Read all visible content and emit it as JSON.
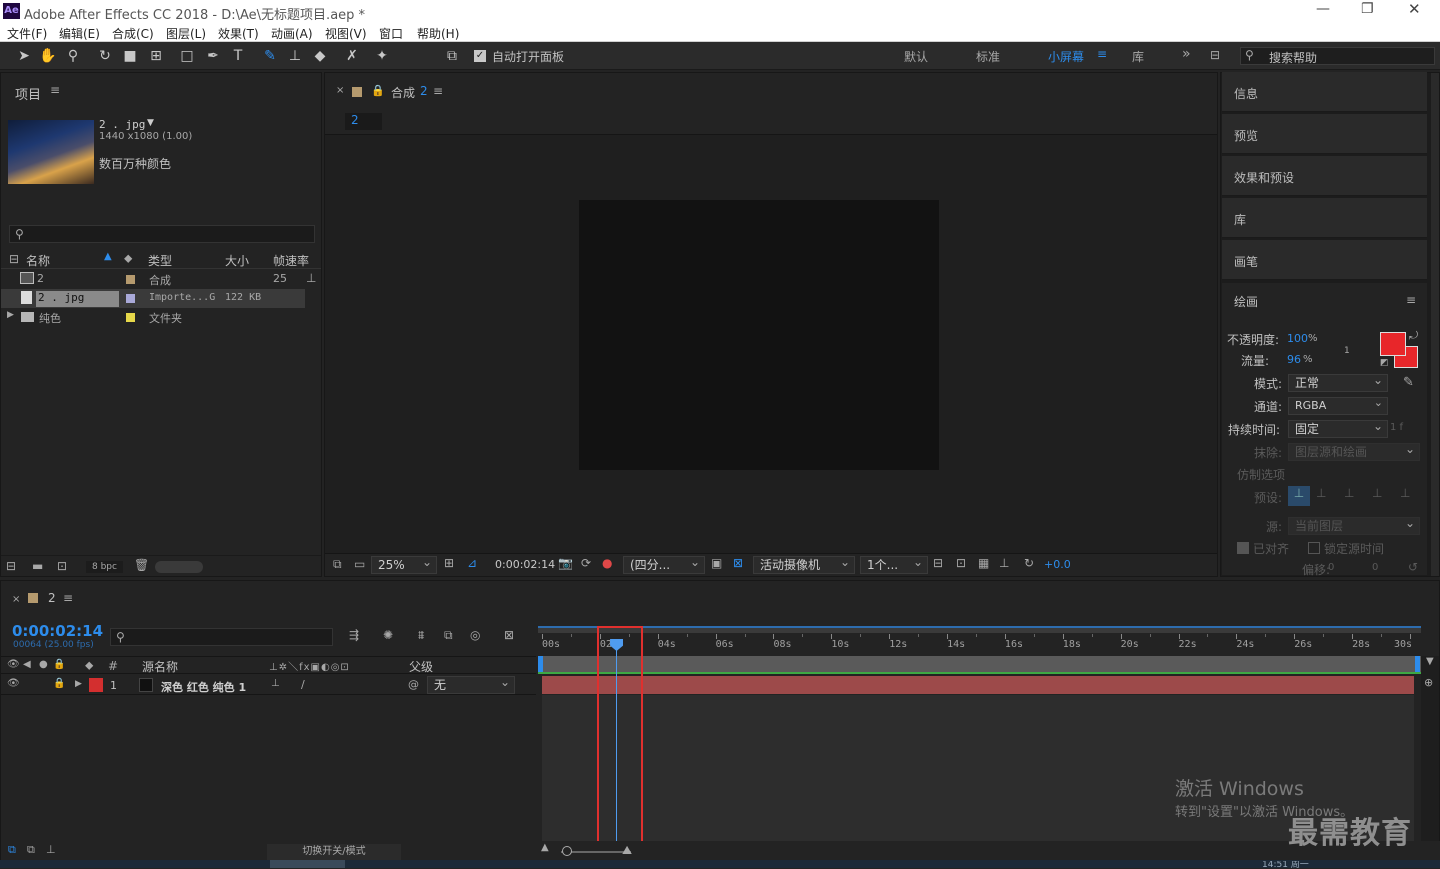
{
  "app": {
    "logo": "Ae",
    "title": "Adobe After Effects CC 2018 - D:\\Ae\\无标题项目.aep *"
  },
  "menu": [
    "文件(F)",
    "编辑(E)",
    "合成(C)",
    "图层(L)",
    "效果(T)",
    "动画(A)",
    "视图(V)",
    "窗口",
    "帮助(H)"
  ],
  "toolbar": {
    "auto_open_label": "自动打开面板",
    "workspaces": [
      "默认",
      "标准",
      "小屏幕",
      "库"
    ],
    "active_workspace": "小屏幕",
    "search_placeholder": "搜索帮助"
  },
  "project": {
    "panel_title": "项目",
    "preview": {
      "name": "2 . jpg",
      "dims": "1440 x1080 (1.00)",
      "colors": "数百万种颜色"
    },
    "columns": [
      "名称",
      "类型",
      "大小",
      "帧速率"
    ],
    "items": [
      {
        "name": "2",
        "type": "合成",
        "size": "",
        "fps": "25",
        "color": "#b59a6e"
      },
      {
        "name": "2 . jpg",
        "type": "Importe...G",
        "size": "122 KB",
        "fps": "",
        "color": "#a9a9d8"
      },
      {
        "name": "纯色",
        "type": "文件夹",
        "size": "",
        "fps": "",
        "color": "#e6d84a"
      }
    ],
    "bpc": "8 bpc"
  },
  "composition": {
    "tab_label": "合成",
    "tab_number": "2",
    "sub_tab": "2",
    "zoom": "25%",
    "timecode": "0:00:02:14",
    "view": "(四分...",
    "camera": "活动摄像机",
    "views": "1个...",
    "exposure": "+0.0"
  },
  "right_panels": [
    "信息",
    "预览",
    "效果和预设",
    "库",
    "画笔"
  ],
  "paint": {
    "title": "绘画",
    "opacity_label": "不透明度:",
    "opacity_value": "100",
    "opacity_unit": "%",
    "flow_label": "流量:",
    "flow_value": "96",
    "flow_unit": "%",
    "mode_label": "模式:",
    "mode_value": "正常",
    "channel_label": "通道:",
    "channel_value": "RGBA",
    "duration_label": "持续时间:",
    "duration_value": "固定",
    "duration_extra": "1 f",
    "erase_label": "抹除:",
    "erase_value": "图层源和绘画",
    "clone_label": "仿制选项",
    "preset_label": "预设:",
    "source_label": "源:",
    "source_value": "当前图层",
    "aligned_label": "已对齐",
    "lock_label": "锁定源时间",
    "offset_label": "偏移:",
    "offset_x": "0",
    "offset_y": "0",
    "fg_color": "#e8262a",
    "bg_color": "#e8262a",
    "small_number": "1"
  },
  "timeline": {
    "comp_tab": "2",
    "timecode": "0:00:02:14",
    "frames": "00064 (25.00 fps)",
    "columns": {
      "source": "源名称",
      "parent": "父级",
      "num": "#"
    },
    "layer": {
      "num": "1",
      "name": "深色 红色 纯色 1",
      "parent": "无",
      "color": "#d32f2f"
    },
    "ruler": [
      "00s",
      "02s",
      "04s",
      "06s",
      "08s",
      "10s",
      "12s",
      "14s",
      "16s",
      "18s",
      "20s",
      "22s",
      "24s",
      "26s",
      "28s",
      "30s"
    ],
    "playhead_sec": 2.56,
    "duration_sec": 30,
    "toggle_label": "切换开关/模式"
  },
  "watermark": {
    "line1": "激活 Windows",
    "line2": "转到\"设置\"以激活 Windows。",
    "brand": "最需教育",
    "clock": "14:51 周一"
  }
}
